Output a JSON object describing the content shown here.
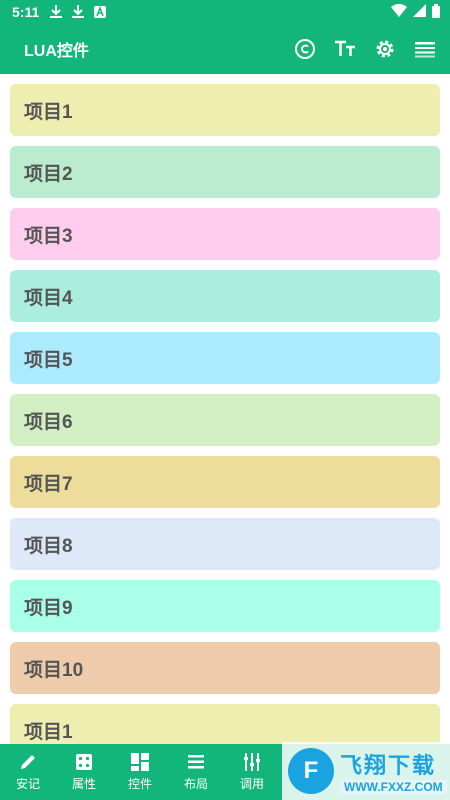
{
  "status_bar": {
    "time": "5:11"
  },
  "app_bar": {
    "title": "LUA控件"
  },
  "items": [
    {
      "label": "项目1",
      "color": "#eeeeb0"
    },
    {
      "label": "项目2",
      "color": "#bbecd0"
    },
    {
      "label": "项目3",
      "color": "#ffcdee"
    },
    {
      "label": "项目4",
      "color": "#abeedd"
    },
    {
      "label": "项目5",
      "color": "#abebfd"
    },
    {
      "label": "项目6",
      "color": "#d1efc2"
    },
    {
      "label": "项目7",
      "color": "#eedd9a"
    },
    {
      "label": "项目8",
      "color": "#dde9f8"
    },
    {
      "label": "项目9",
      "color": "#aaffe9"
    },
    {
      "label": "项目10",
      "color": "#eeccab"
    },
    {
      "label": "项目1",
      "color": "#eeeeb0"
    }
  ],
  "bottom_nav": [
    {
      "label": "安记",
      "icon": "pencil-icon"
    },
    {
      "label": "属性",
      "icon": "dice-icon"
    },
    {
      "label": "控件",
      "icon": "grid-icon"
    },
    {
      "label": "布局",
      "icon": "list-icon"
    },
    {
      "label": "调用",
      "icon": "sliders-icon"
    }
  ],
  "watermark": {
    "logo_char": "F",
    "name": "飞翔下载",
    "url": "WWW.FXXZ.COM"
  },
  "colors": {
    "primary": "#12b57a",
    "item_text": "#555555"
  }
}
